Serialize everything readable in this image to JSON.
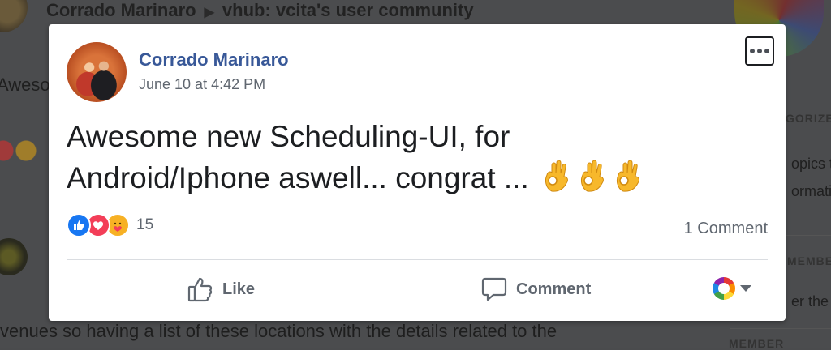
{
  "background": {
    "author": "Corrado Marinaro",
    "group": "vhub: vcita's user community",
    "snippet_top": "Awesome",
    "snippet_bottom": "venues so having a list of these locations with the details related to the",
    "side_heading_1": "GORIZE",
    "side_text_1": "opics to",
    "side_text_2": "ormatio",
    "side_heading_2": "MEMBE",
    "side_text_3": "er the",
    "side_heading_3": "MEMBER"
  },
  "post": {
    "author": "Corrado Marinaro",
    "timestamp": "June 10 at 4:42 PM",
    "text_line1": "Awesome new Scheduling-UI, for",
    "text_line2": "Android/Iphone aswell... congrat ...",
    "emoji_count": 3,
    "reaction_count": "15",
    "comment_count": "1 Comment"
  },
  "actions": {
    "like_label": "Like",
    "comment_label": "Comment"
  },
  "colors": {
    "author_link": "#385898",
    "like_blue": "#1877f2",
    "love_red": "#f33e58",
    "care_yellow": "#f7b125"
  },
  "icons": [
    "more-options-icon",
    "like-reaction-icon",
    "love-reaction-icon",
    "care-reaction-icon",
    "thumbs-up-icon",
    "comment-bubble-icon",
    "audience-avatar-icon",
    "caret-down-icon",
    "ok-hand-emoji"
  ]
}
